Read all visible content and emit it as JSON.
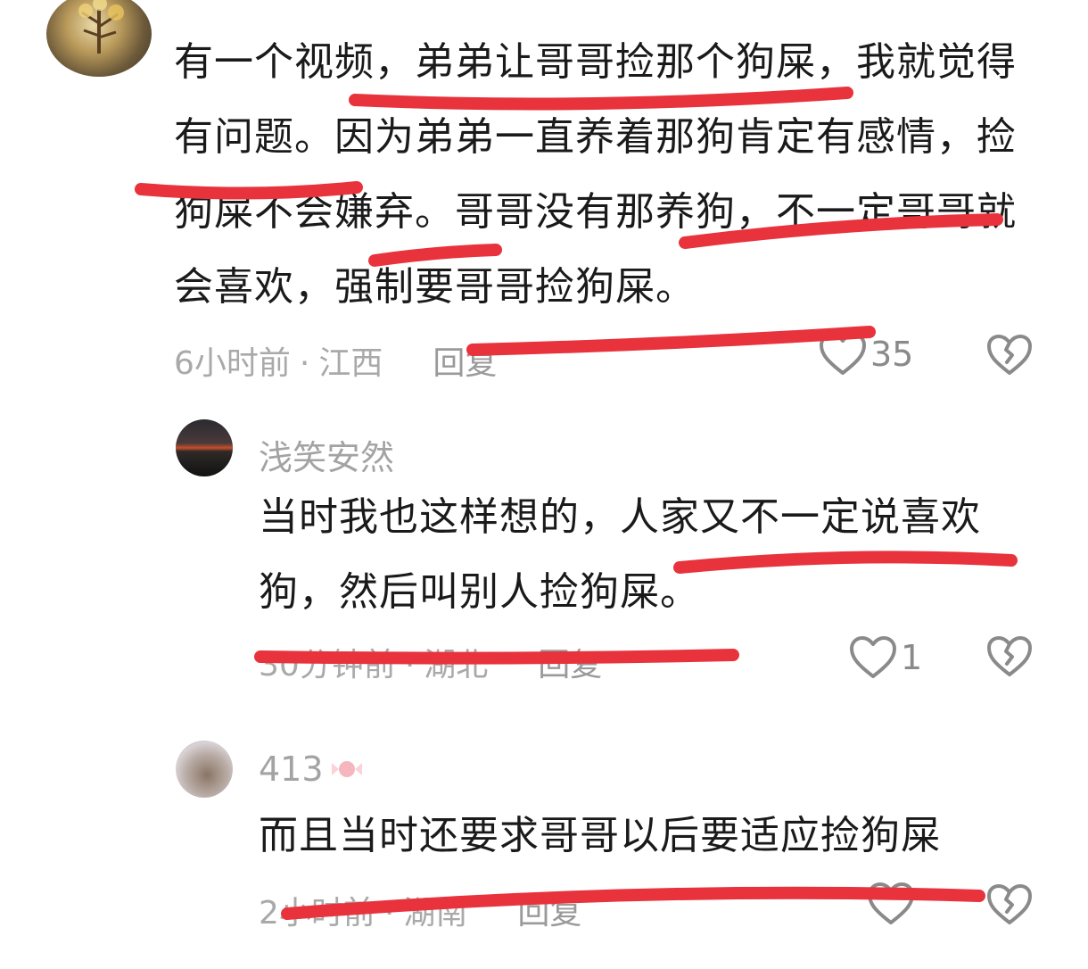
{
  "comments": [
    {
      "text": "有一个视频，弟弟让哥哥捡那个狗屎，我就觉得有问题。因为弟弟一直养着那狗肯定有感情，捡狗屎不会嫌弃。哥哥没有那养狗，不一定哥哥就会喜欢，强制要哥哥捡狗屎。",
      "time": "6小时前",
      "location": "江西",
      "reply_label": "回复",
      "like_count": "35"
    },
    {
      "username": "浅笑安然",
      "text": "当时我也这样想的，人家又不一定说喜欢狗，然后叫别人捡狗屎。",
      "time": "30分钟前",
      "location": "湖北",
      "reply_label": "回复",
      "like_count": "1"
    },
    {
      "username": "413",
      "text": "而且当时还要求哥哥以后要适应捡狗屎",
      "time": "2小时前",
      "location": "湖南",
      "reply_label": "回复",
      "like_count": ""
    }
  ],
  "meta_separator": "·",
  "icons": {
    "like": "heart-outline-icon",
    "dislike": "broken-heart-icon",
    "username_badge": "candy-icon"
  },
  "colors": {
    "annotation_stroke": "#e8323c",
    "meta_text": "#a9a9a9"
  }
}
